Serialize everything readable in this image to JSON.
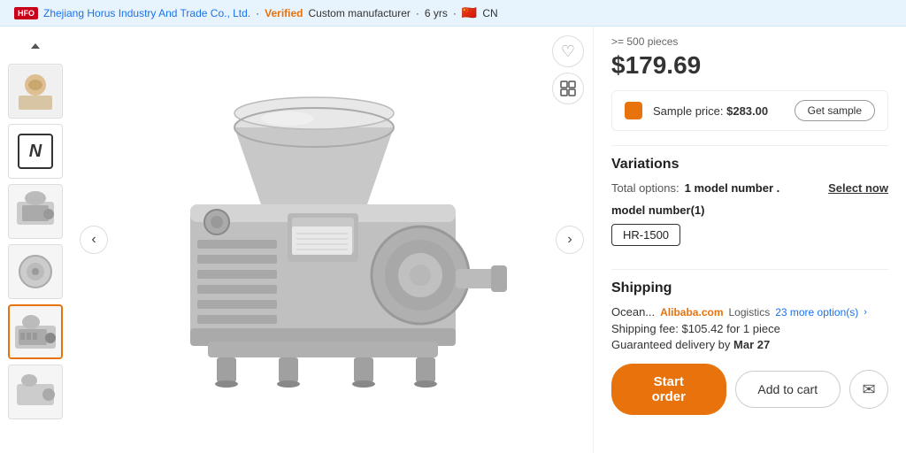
{
  "company": {
    "logo_text": "HFO",
    "name": "Zhejiang Horus Industry And Trade Co., Ltd.",
    "verified_label": "Verified",
    "type": "Custom manufacturer",
    "years": "6 yrs",
    "country_flag": "🇨🇳",
    "country_code": "CN"
  },
  "product": {
    "min_order_label": ">= 500 pieces",
    "price": "$179.69",
    "sample_label": "Sample price:",
    "sample_price": "$283.00",
    "get_sample_btn": "Get sample",
    "wishlist_icon": "♡",
    "zoom_icon": "⊞"
  },
  "variations": {
    "title": "Variations",
    "total_label": "Total options:",
    "total_value": "1 model number .",
    "select_now": "Select now",
    "model_label": "model number(1)",
    "model_chip": "HR-1500"
  },
  "shipping": {
    "title": "Shipping",
    "method": "Ocean...",
    "platform": "Alibaba.com",
    "logistics": "Logistics",
    "more_options": "23 more option(s)",
    "fee_label": "Shipping fee:",
    "fee_value": "$105.42 for 1 piece",
    "delivery_label": "Guaranteed delivery by",
    "delivery_date": "Mar 27"
  },
  "actions": {
    "start_order": "Start order",
    "add_to_cart": "Add to cart",
    "message_icon": "✉"
  },
  "thumbnails": [
    {
      "id": "thumb-up",
      "label": "scroll up"
    },
    {
      "id": "thumb-1",
      "label": "product view 1",
      "active": false
    },
    {
      "id": "thumb-brand",
      "label": "brand logo",
      "active": false
    },
    {
      "id": "thumb-2",
      "label": "product view 2",
      "active": false
    },
    {
      "id": "thumb-3",
      "label": "product view 3",
      "active": false
    },
    {
      "id": "thumb-4",
      "label": "product view 4",
      "active": true
    },
    {
      "id": "thumb-5",
      "label": "product view 5",
      "active": false
    }
  ]
}
